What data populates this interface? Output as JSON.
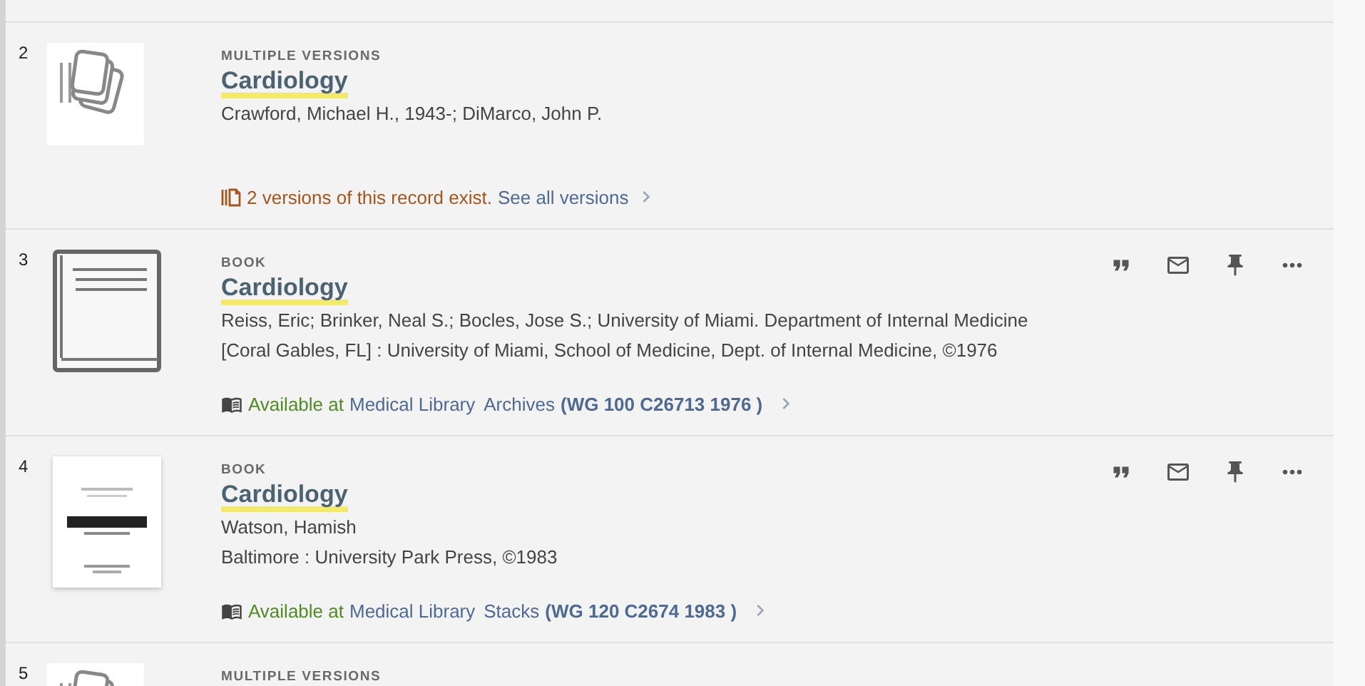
{
  "results": [
    {
      "number": "2",
      "thumbnail": {
        "kind": "versions"
      },
      "type_label": "MULTIPLE VERSIONS",
      "title": "Cardiology",
      "creators": "Crawford, Michael H., 1943-; DiMarco, John P.",
      "versions": {
        "text": "2 versions of this record exist.",
        "link": "See all versions"
      }
    },
    {
      "number": "3",
      "thumbnail": {
        "kind": "book"
      },
      "type_label": "BOOK",
      "title": "Cardiology",
      "creators": "Reiss, Eric; Brinker, Neal S.; Bocles, Jose S.; University of Miami. Department of Internal Medicine",
      "publication": "[Coral Gables, FL] : University of Miami, School of Medicine, Dept. of Internal Medicine, ©1976",
      "availability": {
        "status": "Available at",
        "library": "Medical Library",
        "location": "Archives",
        "call_number": "(WG 100 C26713 1976 )"
      },
      "actions": [
        {
          "kind": "cite"
        },
        {
          "kind": "email"
        },
        {
          "kind": "pin"
        },
        {
          "kind": "more"
        }
      ]
    },
    {
      "number": "4",
      "type_label": "BOOK",
      "title": "Cardiology",
      "creators": "Watson, Hamish",
      "publication": "Baltimore : University Park Press, ©1983",
      "availability": {
        "status": "Available at",
        "library": "Medical Library",
        "location": "Stacks",
        "call_number": "(WG 120 C2674 1983 )"
      },
      "actions": [
        {
          "kind": "cite"
        },
        {
          "kind": "email"
        },
        {
          "kind": "pin"
        },
        {
          "kind": "more"
        }
      ]
    },
    {
      "number": "5",
      "thumbnail": {
        "kind": "versions"
      },
      "type_label": "MULTIPLE VERSIONS"
    }
  ]
}
